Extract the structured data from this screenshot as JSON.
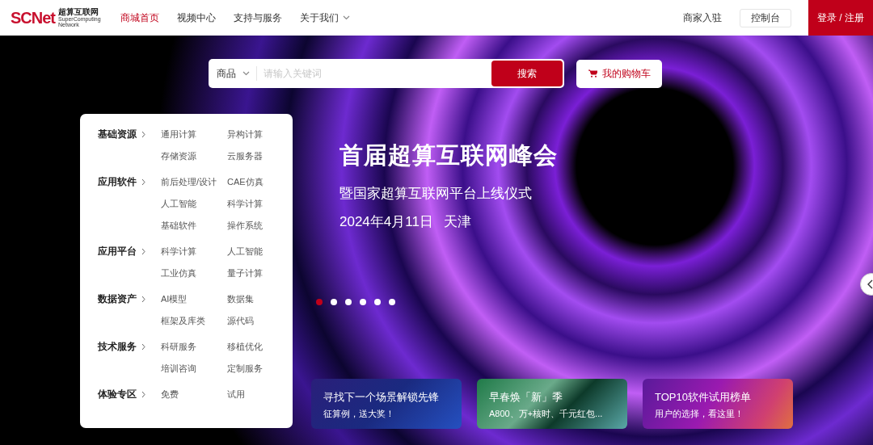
{
  "logo": {
    "mark": "SCNet",
    "name": "超算互联网",
    "sub_1": "SuperComputing",
    "sub_2": "Network"
  },
  "nav": [
    {
      "label": "商城首页",
      "selected": true,
      "dropdown": false
    },
    {
      "label": "视频中心",
      "selected": false,
      "dropdown": false
    },
    {
      "label": "支持与服务",
      "selected": false,
      "dropdown": false
    },
    {
      "label": "关于我们",
      "selected": false,
      "dropdown": true
    }
  ],
  "header_right": {
    "merchant": "商家入驻",
    "console": "控制台",
    "login": "登录 / 注册"
  },
  "search": {
    "category": "商品",
    "placeholder": "请输入关键词",
    "button": "搜索"
  },
  "cart": "我的购物车",
  "menu": [
    {
      "title": "基础资源",
      "items": [
        "通用计算",
        "异构计算",
        "存储资源",
        "云服务器"
      ]
    },
    {
      "title": "应用软件",
      "items": [
        "前后处理/设计",
        "CAE仿真",
        "人工智能",
        "科学计算",
        "基础软件",
        "操作系统"
      ]
    },
    {
      "title": "应用平台",
      "items": [
        "科学计算",
        "人工智能",
        "工业仿真",
        "量子计算"
      ]
    },
    {
      "title": "数据资产",
      "items": [
        "AI模型",
        "数据集",
        "框架及库类",
        "源代码"
      ]
    },
    {
      "title": "技术服务",
      "items": [
        "科研服务",
        "移植优化",
        "培训咨询",
        "定制服务"
      ]
    },
    {
      "title": "体验专区",
      "items": [
        "免费",
        "试用"
      ]
    }
  ],
  "banner": {
    "headline": "首届超算互联网峰会",
    "subtitle": "暨国家超算互联网平台上线仪式",
    "date": "2024年4月11日",
    "city": "天津"
  },
  "carousel_dots": [
    {
      "selected": true
    },
    {
      "selected": false
    },
    {
      "selected": false
    },
    {
      "selected": false
    },
    {
      "selected": false
    },
    {
      "selected": false
    }
  ],
  "promo_cards": [
    {
      "title": "寻找下一个场景解锁先锋",
      "text": "征算例，送大奖！",
      "kind": "blue"
    },
    {
      "title": "早春焕「新」季",
      "text": "A800、万+核时、千元红包...",
      "kind": "green"
    },
    {
      "title": "TOP10软件试用榜单",
      "text": "用户的选择，看这里！",
      "kind": "purple"
    }
  ]
}
